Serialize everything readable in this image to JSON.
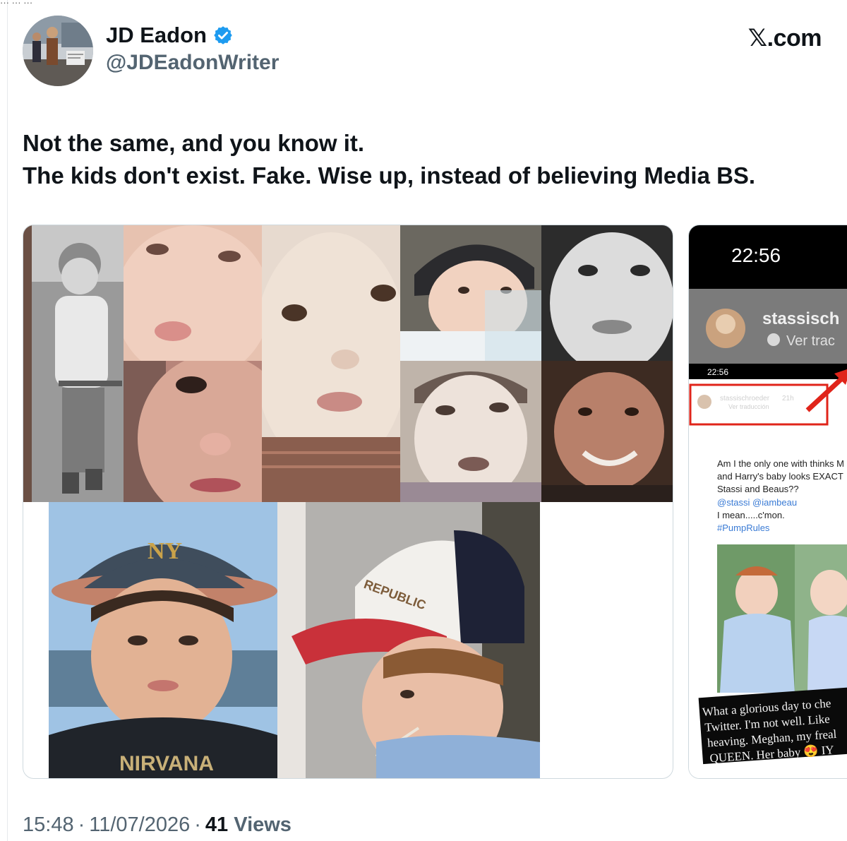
{
  "top_fragment": "··· ··· ···",
  "author": {
    "name": "JD Eadon",
    "handle": "@JDEadonWriter",
    "verified_color": "#1d9bf0"
  },
  "site_label": "𝕏.com",
  "tweet": {
    "lines": [
      "Not the same, and you know it.",
      "The kids don't exist. Fake. Wise up, instead of believing Media BS."
    ]
  },
  "media_collage": {
    "cap_text": "NY",
    "cap2_text": "REPUBLIC",
    "shirt_text": "NIRVANA"
  },
  "media_screenshot": {
    "clock": "22:56",
    "story_user": "stassisch",
    "story_translate": "Ver trac",
    "inner_clock": "22:56",
    "inner_user": "stassischroeder",
    "inner_time": "21h",
    "inner_translate": "Ver traducción",
    "post_lines": [
      "Am I the only one with thinks M",
      "and Harry's baby looks EXACT",
      "Stassi and Beaus??"
    ],
    "mentions": "@stassi @iambeau",
    "post_line4": "I mean.....c'mon.",
    "hashtag": "#PumpRules",
    "caption_lines": [
      "What a glorious day to che",
      "Twitter. I'm not well. Like",
      "heaving. Meghan, my freal",
      "QUEEN. Her baby 😍 IY"
    ],
    "link_color": "#3a7bd5",
    "arrow_color": "#e0241a"
  },
  "footer": {
    "time": "15:48",
    "date": "11/07/2026",
    "views_count": "41",
    "views_label": "Views",
    "separator": "·"
  }
}
